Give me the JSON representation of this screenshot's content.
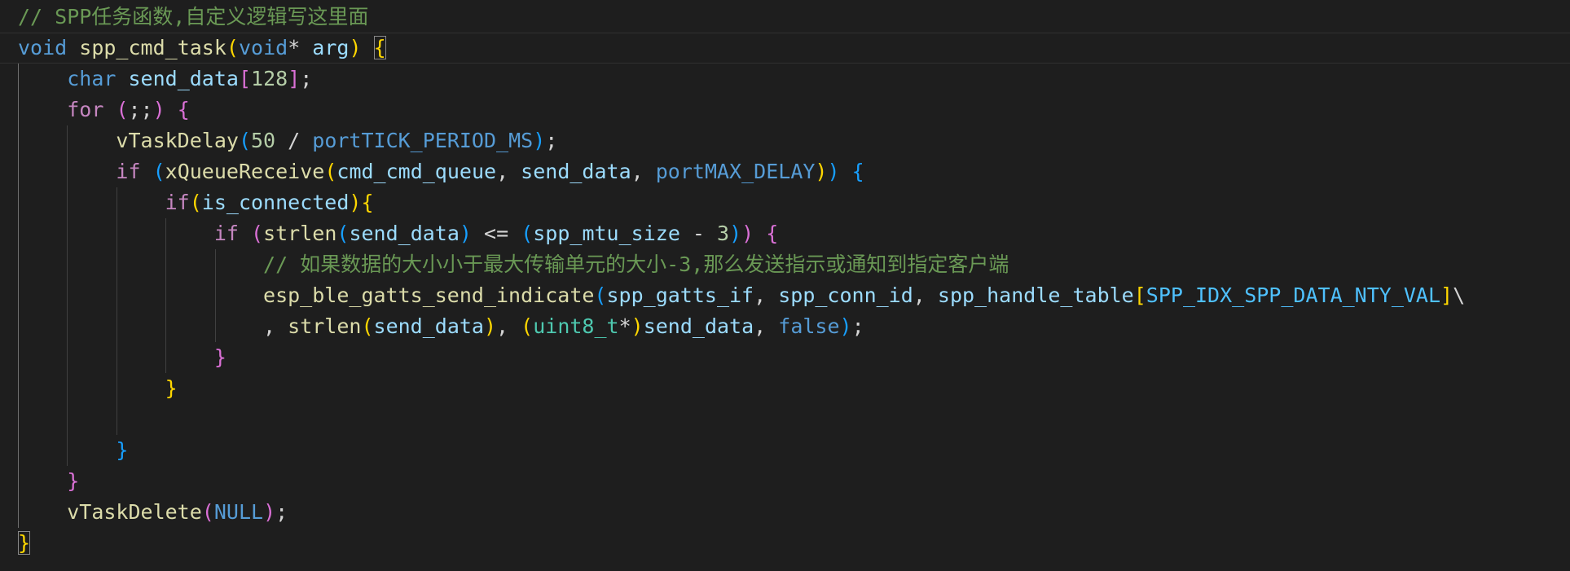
{
  "editor": {
    "language": "c",
    "theme_colors": {
      "background": "#1e1e1e",
      "comment": "#6a9955",
      "keyword": "#569cd6",
      "control": "#c586c0",
      "function": "#dcdcaa",
      "variable": "#9cdcfe",
      "number": "#b5cea8",
      "type": "#4ec9b0",
      "constant": "#4fc1ff",
      "bracket_level1": "#ffd700",
      "bracket_level2": "#da70d6",
      "bracket_level3": "#179fff"
    },
    "lines": [
      {
        "id": "l1",
        "text": "// SPP任务函数,自定义逻辑写这里面"
      },
      {
        "id": "l2",
        "text": "void spp_cmd_task(void* arg) {"
      },
      {
        "id": "l3",
        "text": "    char send_data[128];"
      },
      {
        "id": "l4",
        "text": "    for (;;) {"
      },
      {
        "id": "l5",
        "text": "        vTaskDelay(50 / portTICK_PERIOD_MS);"
      },
      {
        "id": "l6",
        "text": "        if (xQueueReceive(cmd_cmd_queue, send_data, portMAX_DELAY)) {"
      },
      {
        "id": "l7",
        "text": "            if(is_connected){"
      },
      {
        "id": "l8",
        "text": "                if (strlen(send_data) <= (spp_mtu_size - 3)) {"
      },
      {
        "id": "l9",
        "text": "                    // 如果数据的大小小于最大传输单元的大小-3,那么发送指示或通知到指定客户端"
      },
      {
        "id": "l10",
        "text": "                    esp_ble_gatts_send_indicate(spp_gatts_if, spp_conn_id, spp_handle_table[SPP_IDX_SPP_DATA_NTY_VAL]\\"
      },
      {
        "id": "l11",
        "text": "                    , strlen(send_data), (uint8_t*)send_data, false);"
      },
      {
        "id": "l12",
        "text": "                }"
      },
      {
        "id": "l13",
        "text": "            }"
      },
      {
        "id": "l14",
        "text": ""
      },
      {
        "id": "l15",
        "text": "        }"
      },
      {
        "id": "l16",
        "text": "    }"
      },
      {
        "id": "l17",
        "text": "    vTaskDelete(NULL);"
      },
      {
        "id": "l18",
        "text": "}"
      }
    ],
    "tokens": {
      "l1": [
        {
          "t": "// SPP任务函数,自定义逻辑写这里面",
          "c": "c-comment"
        }
      ],
      "l2": [
        {
          "t": "void",
          "c": "c-kw"
        },
        {
          "t": " ",
          "c": ""
        },
        {
          "t": "spp_cmd_task",
          "c": "c-fn"
        },
        {
          "t": "(",
          "c": "b1"
        },
        {
          "t": "void",
          "c": "c-kw"
        },
        {
          "t": "* ",
          "c": "c-op"
        },
        {
          "t": "arg",
          "c": "c-var"
        },
        {
          "t": ")",
          "c": "b1"
        },
        {
          "t": " ",
          "c": ""
        },
        {
          "t": "{",
          "c": "b1 bm"
        }
      ],
      "l3": [
        {
          "t": "    ",
          "c": ""
        },
        {
          "t": "char",
          "c": "c-kw"
        },
        {
          "t": " ",
          "c": ""
        },
        {
          "t": "send_data",
          "c": "c-var"
        },
        {
          "t": "[",
          "c": "b2"
        },
        {
          "t": "128",
          "c": "c-num"
        },
        {
          "t": "]",
          "c": "b2"
        },
        {
          "t": ";",
          "c": "c-op"
        }
      ],
      "l4": [
        {
          "t": "    ",
          "c": ""
        },
        {
          "t": "for",
          "c": "c-ctrl"
        },
        {
          "t": " ",
          "c": ""
        },
        {
          "t": "(",
          "c": "b2"
        },
        {
          "t": ";;",
          "c": "c-op"
        },
        {
          "t": ")",
          "c": "b2"
        },
        {
          "t": " ",
          "c": ""
        },
        {
          "t": "{",
          "c": "b2"
        }
      ],
      "l5": [
        {
          "t": "        ",
          "c": ""
        },
        {
          "t": "vTaskDelay",
          "c": "c-fn"
        },
        {
          "t": "(",
          "c": "b3"
        },
        {
          "t": "50",
          "c": "c-num"
        },
        {
          "t": " / ",
          "c": "c-op"
        },
        {
          "t": "portTICK_PERIOD_MS",
          "c": "c-macro"
        },
        {
          "t": ")",
          "c": "b3"
        },
        {
          "t": ";",
          "c": "c-op"
        }
      ],
      "l6": [
        {
          "t": "        ",
          "c": ""
        },
        {
          "t": "if",
          "c": "c-ctrl"
        },
        {
          "t": " ",
          "c": ""
        },
        {
          "t": "(",
          "c": "b3"
        },
        {
          "t": "xQueueReceive",
          "c": "c-fn"
        },
        {
          "t": "(",
          "c": "b1"
        },
        {
          "t": "cmd_cmd_queue",
          "c": "c-var"
        },
        {
          "t": ", ",
          "c": "c-op"
        },
        {
          "t": "send_data",
          "c": "c-var"
        },
        {
          "t": ", ",
          "c": "c-op"
        },
        {
          "t": "portMAX_DELAY",
          "c": "c-macro"
        },
        {
          "t": ")",
          "c": "b1"
        },
        {
          "t": ")",
          "c": "b3"
        },
        {
          "t": " ",
          "c": ""
        },
        {
          "t": "{",
          "c": "b3"
        }
      ],
      "l7": [
        {
          "t": "            ",
          "c": ""
        },
        {
          "t": "if",
          "c": "c-ctrl"
        },
        {
          "t": "(",
          "c": "b1"
        },
        {
          "t": "is_connected",
          "c": "c-var"
        },
        {
          "t": ")",
          "c": "b1"
        },
        {
          "t": "{",
          "c": "b1"
        }
      ],
      "l8": [
        {
          "t": "                ",
          "c": ""
        },
        {
          "t": "if",
          "c": "c-ctrl"
        },
        {
          "t": " ",
          "c": ""
        },
        {
          "t": "(",
          "c": "b2"
        },
        {
          "t": "strlen",
          "c": "c-fn"
        },
        {
          "t": "(",
          "c": "b3"
        },
        {
          "t": "send_data",
          "c": "c-var"
        },
        {
          "t": ")",
          "c": "b3"
        },
        {
          "t": " <= ",
          "c": "c-op"
        },
        {
          "t": "(",
          "c": "b3"
        },
        {
          "t": "spp_mtu_size",
          "c": "c-var"
        },
        {
          "t": " - ",
          "c": "c-op"
        },
        {
          "t": "3",
          "c": "c-num"
        },
        {
          "t": ")",
          "c": "b3"
        },
        {
          "t": ")",
          "c": "b2"
        },
        {
          "t": " ",
          "c": ""
        },
        {
          "t": "{",
          "c": "b2"
        }
      ],
      "l9": [
        {
          "t": "                    ",
          "c": ""
        },
        {
          "t": "// 如果数据的大小小于最大传输单元的大小-3,那么发送指示或通知到指定客户端",
          "c": "c-comment"
        }
      ],
      "l10": [
        {
          "t": "                    ",
          "c": ""
        },
        {
          "t": "esp_ble_gatts_send_indicate",
          "c": "c-fn"
        },
        {
          "t": "(",
          "c": "b3"
        },
        {
          "t": "spp_gatts_if",
          "c": "c-var"
        },
        {
          "t": ", ",
          "c": "c-op"
        },
        {
          "t": "spp_conn_id",
          "c": "c-var"
        },
        {
          "t": ", ",
          "c": "c-op"
        },
        {
          "t": "spp_handle_table",
          "c": "c-var"
        },
        {
          "t": "[",
          "c": "b1"
        },
        {
          "t": "SPP_IDX_SPP_DATA_NTY_VAL",
          "c": "c-const"
        },
        {
          "t": "]",
          "c": "b1"
        },
        {
          "t": "\\",
          "c": "c-op"
        }
      ],
      "l11": [
        {
          "t": "                    ",
          "c": ""
        },
        {
          "t": ", ",
          "c": "c-op"
        },
        {
          "t": "strlen",
          "c": "c-fn"
        },
        {
          "t": "(",
          "c": "b1"
        },
        {
          "t": "send_data",
          "c": "c-var"
        },
        {
          "t": ")",
          "c": "b1"
        },
        {
          "t": ", ",
          "c": "c-op"
        },
        {
          "t": "(",
          "c": "b1"
        },
        {
          "t": "uint8_t",
          "c": "c-type"
        },
        {
          "t": "*",
          "c": "c-op"
        },
        {
          "t": ")",
          "c": "b1"
        },
        {
          "t": "send_data",
          "c": "c-var"
        },
        {
          "t": ", ",
          "c": "c-op"
        },
        {
          "t": "false",
          "c": "c-kw"
        },
        {
          "t": ")",
          "c": "b3"
        },
        {
          "t": ";",
          "c": "c-op"
        }
      ],
      "l12": [
        {
          "t": "                ",
          "c": ""
        },
        {
          "t": "}",
          "c": "b2"
        }
      ],
      "l13": [
        {
          "t": "            ",
          "c": ""
        },
        {
          "t": "}",
          "c": "b1"
        }
      ],
      "l14": [],
      "l15": [
        {
          "t": "        ",
          "c": ""
        },
        {
          "t": "}",
          "c": "b3"
        }
      ],
      "l16": [
        {
          "t": "    ",
          "c": ""
        },
        {
          "t": "}",
          "c": "b2"
        }
      ],
      "l17": [
        {
          "t": "    ",
          "c": ""
        },
        {
          "t": "vTaskDelete",
          "c": "c-fn"
        },
        {
          "t": "(",
          "c": "b2"
        },
        {
          "t": "NULL",
          "c": "c-macro"
        },
        {
          "t": ")",
          "c": "b2"
        },
        {
          "t": ";",
          "c": "c-op"
        }
      ],
      "l18": [
        {
          "t": "}",
          "c": "b1 bm"
        }
      ]
    }
  }
}
